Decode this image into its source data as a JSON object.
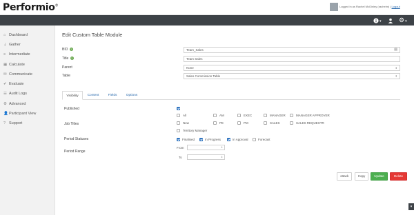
{
  "app": {
    "logo": "Performio",
    "logo_mark": "®"
  },
  "user": {
    "logged_in_prefix": "Logged in as Rachel McGinley (rachelm) |",
    "logout": "Logout"
  },
  "topnav": {
    "info_icon": "info-icon",
    "user_icon": "user-icon",
    "settings_icon": "gear-icon"
  },
  "sidebar": {
    "items": [
      {
        "label": "Dashboard",
        "icon": "⌂"
      },
      {
        "label": "Gather",
        "icon": "⇣"
      },
      {
        "label": "Intermediate",
        "icon": "≡"
      },
      {
        "label": "Calculate",
        "icon": "▦"
      },
      {
        "label": "Communicate",
        "icon": "✉"
      },
      {
        "label": "Evaluate",
        "icon": "✔"
      },
      {
        "label": "Audit Logs",
        "icon": "☰"
      },
      {
        "label": "Advanced",
        "icon": "⚙"
      },
      {
        "label": "Participant View",
        "icon": "👤"
      },
      {
        "label": "Support",
        "icon": "?"
      }
    ]
  },
  "page": {
    "title": "Edit Custom Table Module"
  },
  "form": {
    "bid_label": "BID",
    "bid_value": "Team_Sales",
    "title_label": "Title",
    "title_value": "Team Sales",
    "parent_label": "Parent",
    "parent_value": "None",
    "table_label": "Table",
    "table_value": "Sales Commission Table"
  },
  "tabs": [
    {
      "label": "Visibility"
    },
    {
      "label": "Content"
    },
    {
      "label": "Fields"
    },
    {
      "label": "Options"
    }
  ],
  "visibility": {
    "published_label": "Published",
    "published_checked": true,
    "job_titles_label": "Job Titles",
    "job_titles": [
      {
        "label": "All",
        "checked": false
      },
      {
        "label": "AM",
        "checked": false
      },
      {
        "label": "EXEC",
        "checked": false
      },
      {
        "label": "MANAGER",
        "checked": false
      },
      {
        "label": "MANAGER APPROVER",
        "checked": false
      },
      {
        "label": "New",
        "checked": false
      },
      {
        "label": "PE",
        "checked": false
      },
      {
        "label": "PM",
        "checked": false
      },
      {
        "label": "SALES",
        "checked": false
      },
      {
        "label": "SALES REQUESTR",
        "checked": false
      },
      {
        "label": "Territory Manager",
        "checked": false
      }
    ],
    "period_statuses_label": "Period Statuses",
    "period_statuses": [
      {
        "label": "Finalised",
        "checked": true
      },
      {
        "label": "In Progress",
        "checked": true
      },
      {
        "label": "In Approval",
        "checked": true
      },
      {
        "label": "Forecast",
        "checked": false
      }
    ],
    "period_range_label": "Period Range",
    "from_label": "From",
    "to_label": "To"
  },
  "actions": {
    "back": "«Back",
    "copy": "Copy",
    "update": "Update",
    "delete": "Delete"
  },
  "colors": {
    "navbar": "#3d4247",
    "accent": "#2f74c0",
    "update": "#4caf50",
    "delete": "#e53935"
  }
}
